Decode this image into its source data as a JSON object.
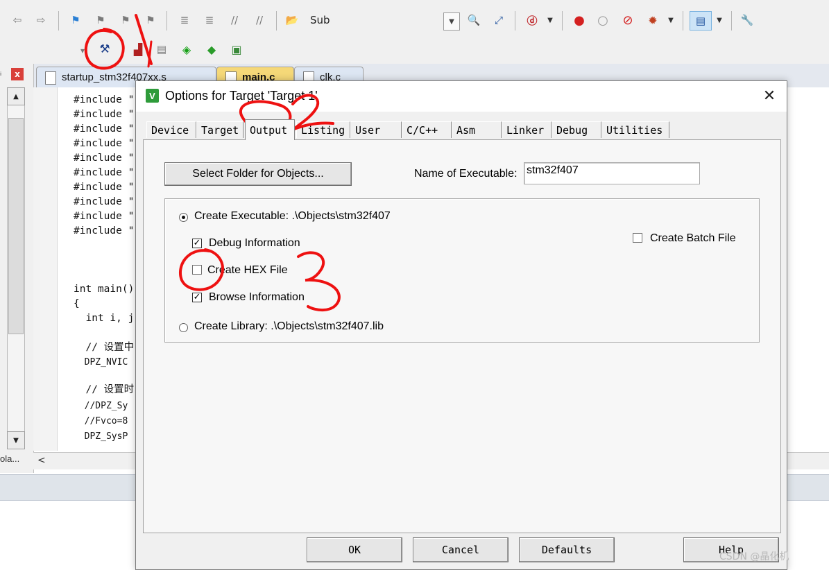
{
  "toolbar": {
    "sub_label": "Sub"
  },
  "file_tabs": [
    {
      "label": "startup_stm32f407xx.s"
    },
    {
      "label": "main.c"
    },
    {
      "label": "clk.c"
    }
  ],
  "code_lines": [
    "#include \"",
    "#include \"",
    "#include \"",
    "#include \"",
    "#include \"",
    "#include \"",
    "#include \"",
    "#include \"",
    "#include \"",
    "#include \""
  ],
  "code_main": {
    "l1": "int main()",
    "l2": "{",
    "l3": "  int i, j",
    "l4": "  // 设置中",
    "l5": "  DPZ_NVIC",
    "l6": "  // 设置时",
    "l7": "  //DPZ_Sy",
    "l8": "  //Fvco=8",
    "l9": "  DPZ_SysP"
  },
  "left_pane": {
    "close_label": "x",
    "bottom_tab": "ola..."
  },
  "dialog": {
    "title": "Options for Target 'Target 1'",
    "close_label": "✕",
    "tabs": [
      {
        "label": "Device",
        "active": false
      },
      {
        "label": "Target",
        "active": false
      },
      {
        "label": "Output",
        "active": true
      },
      {
        "label": "Listing",
        "active": false
      },
      {
        "label": "User",
        "active": false
      },
      {
        "label": "C/C++",
        "active": false
      },
      {
        "label": "Asm",
        "active": false
      },
      {
        "label": "Linker",
        "active": false
      },
      {
        "label": "Debug",
        "active": false
      },
      {
        "label": "Utilities",
        "active": false
      }
    ],
    "select_folder_label": "Select Folder for Objects...",
    "name_of_executable_label": "Name of Executable:",
    "name_of_executable_value": "stm32f407",
    "create_executable_label": "Create Executable:  .\\Objects\\stm32f407",
    "create_executable_selected": true,
    "debug_information_label": "Debug Information",
    "debug_information_checked": true,
    "create_hex_label": "Create HEX File",
    "create_hex_checked": false,
    "browse_information_label": "Browse Information",
    "browse_information_checked": true,
    "create_batch_label": "Create Batch File",
    "create_batch_checked": false,
    "create_library_label": "Create Library:  .\\Objects\\stm32f407.lib",
    "create_library_selected": false,
    "ok_label": "OK",
    "cancel_label": "Cancel",
    "defaults_label": "Defaults",
    "help_label": "Help"
  },
  "annotations": {
    "step1": "1",
    "step2": "2",
    "step3": "3",
    "color": "#ee1111"
  },
  "watermark": "CSDN @晶化机"
}
